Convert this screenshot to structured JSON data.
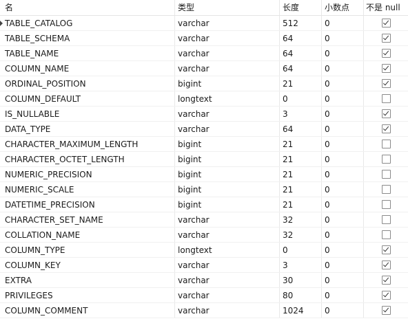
{
  "headers": {
    "name": "名",
    "type": "类型",
    "length": "长度",
    "decimals": "小数点",
    "not_null": "不是 null"
  },
  "rows": [
    {
      "name": "TABLE_CATALOG",
      "type": "varchar",
      "length": "512",
      "decimals": "0",
      "not_null": true
    },
    {
      "name": "TABLE_SCHEMA",
      "type": "varchar",
      "length": "64",
      "decimals": "0",
      "not_null": true
    },
    {
      "name": "TABLE_NAME",
      "type": "varchar",
      "length": "64",
      "decimals": "0",
      "not_null": true
    },
    {
      "name": "COLUMN_NAME",
      "type": "varchar",
      "length": "64",
      "decimals": "0",
      "not_null": true
    },
    {
      "name": "ORDINAL_POSITION",
      "type": "bigint",
      "length": "21",
      "decimals": "0",
      "not_null": true
    },
    {
      "name": "COLUMN_DEFAULT",
      "type": "longtext",
      "length": "0",
      "decimals": "0",
      "not_null": false
    },
    {
      "name": "IS_NULLABLE",
      "type": "varchar",
      "length": "3",
      "decimals": "0",
      "not_null": true
    },
    {
      "name": "DATA_TYPE",
      "type": "varchar",
      "length": "64",
      "decimals": "0",
      "not_null": true
    },
    {
      "name": "CHARACTER_MAXIMUM_LENGTH",
      "type": "bigint",
      "length": "21",
      "decimals": "0",
      "not_null": false
    },
    {
      "name": "CHARACTER_OCTET_LENGTH",
      "type": "bigint",
      "length": "21",
      "decimals": "0",
      "not_null": false
    },
    {
      "name": "NUMERIC_PRECISION",
      "type": "bigint",
      "length": "21",
      "decimals": "0",
      "not_null": false
    },
    {
      "name": "NUMERIC_SCALE",
      "type": "bigint",
      "length": "21",
      "decimals": "0",
      "not_null": false
    },
    {
      "name": "DATETIME_PRECISION",
      "type": "bigint",
      "length": "21",
      "decimals": "0",
      "not_null": false
    },
    {
      "name": "CHARACTER_SET_NAME",
      "type": "varchar",
      "length": "32",
      "decimals": "0",
      "not_null": false
    },
    {
      "name": "COLLATION_NAME",
      "type": "varchar",
      "length": "32",
      "decimals": "0",
      "not_null": false
    },
    {
      "name": "COLUMN_TYPE",
      "type": "longtext",
      "length": "0",
      "decimals": "0",
      "not_null": true
    },
    {
      "name": "COLUMN_KEY",
      "type": "varchar",
      "length": "3",
      "decimals": "0",
      "not_null": true
    },
    {
      "name": "EXTRA",
      "type": "varchar",
      "length": "30",
      "decimals": "0",
      "not_null": true
    },
    {
      "name": "PRIVILEGES",
      "type": "varchar",
      "length": "80",
      "decimals": "0",
      "not_null": true
    },
    {
      "name": "COLUMN_COMMENT",
      "type": "varchar",
      "length": "1024",
      "decimals": "0",
      "not_null": true
    }
  ],
  "current_row": 0
}
